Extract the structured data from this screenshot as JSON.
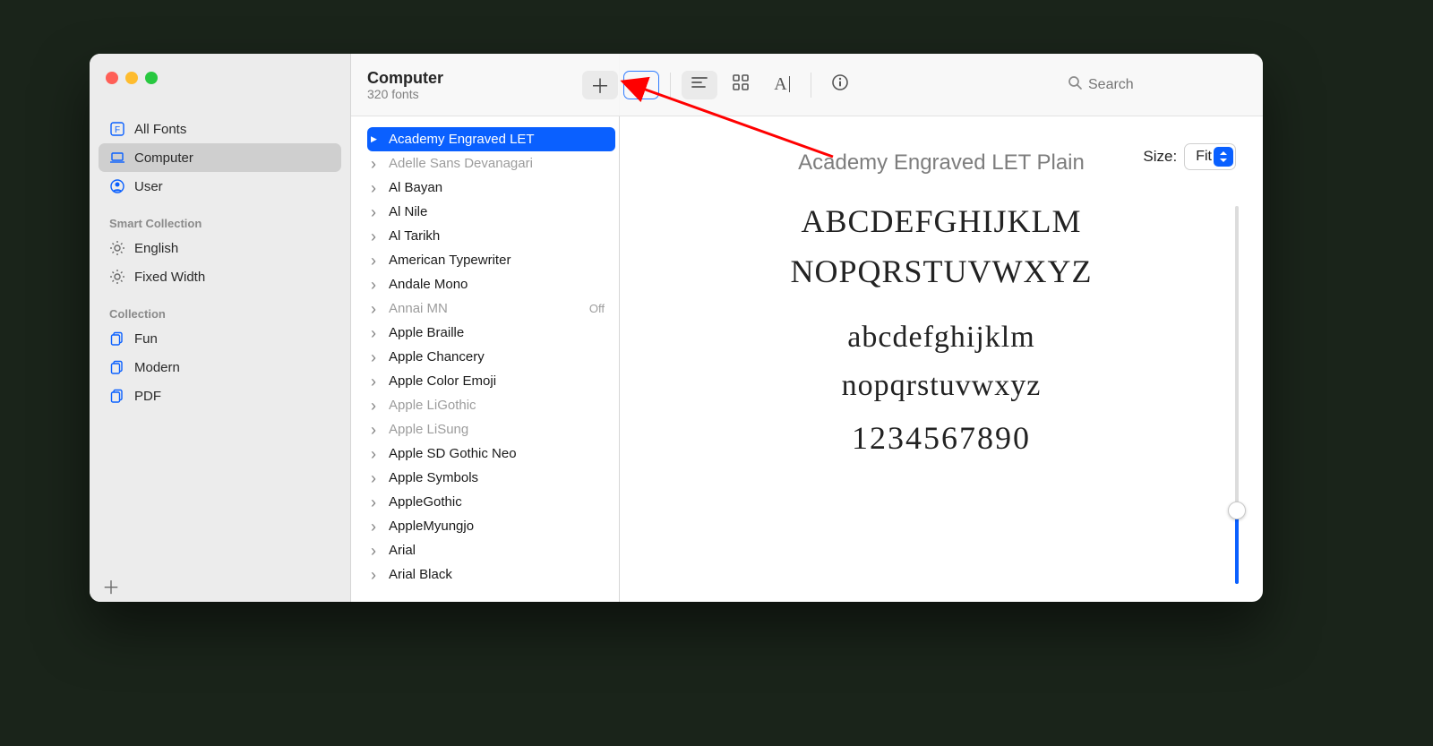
{
  "header": {
    "title": "Computer",
    "subtitle": "320 fonts"
  },
  "search": {
    "placeholder": "Search"
  },
  "sidebar": {
    "library": [
      {
        "label": "All Fonts",
        "icon": "f-icon"
      },
      {
        "label": "Computer",
        "icon": "laptop-icon",
        "selected": true
      },
      {
        "label": "User",
        "icon": "user-icon"
      }
    ],
    "sections": [
      {
        "header": "Smart Collection",
        "items": [
          {
            "label": "English",
            "icon": "gear-icon"
          },
          {
            "label": "Fixed Width",
            "icon": "gear-icon"
          }
        ]
      },
      {
        "header": "Collection",
        "items": [
          {
            "label": "Fun",
            "icon": "copy-icon"
          },
          {
            "label": "Modern",
            "icon": "copy-icon"
          },
          {
            "label": "PDF",
            "icon": "copy-icon"
          }
        ]
      }
    ]
  },
  "fonts": [
    {
      "name": "Academy Engraved LET",
      "selected": true
    },
    {
      "name": "Adelle Sans Devanagari",
      "dim": true
    },
    {
      "name": "Al Bayan"
    },
    {
      "name": "Al Nile"
    },
    {
      "name": "Al Tarikh"
    },
    {
      "name": "American Typewriter"
    },
    {
      "name": "Andale Mono"
    },
    {
      "name": "Annai MN",
      "dim": true,
      "status": "Off"
    },
    {
      "name": "Apple Braille"
    },
    {
      "name": "Apple Chancery"
    },
    {
      "name": "Apple Color Emoji"
    },
    {
      "name": "Apple LiGothic",
      "dim": true
    },
    {
      "name": "Apple LiSung",
      "dim": true
    },
    {
      "name": "Apple SD Gothic Neo"
    },
    {
      "name": "Apple Symbols"
    },
    {
      "name": "AppleGothic"
    },
    {
      "name": "AppleMyungjo"
    },
    {
      "name": "Arial"
    },
    {
      "name": "Arial Black"
    }
  ],
  "preview": {
    "title": "Academy Engraved LET Plain",
    "upper1": "ABCDEFGHIJKLM",
    "upper2": "NOPQRSTUVWXYZ",
    "lower1": "abcdefghijklm",
    "lower2": "nopqrstuvwxyz",
    "digits": "1234567890",
    "size_label": "Size:",
    "size_value": "Fit"
  }
}
